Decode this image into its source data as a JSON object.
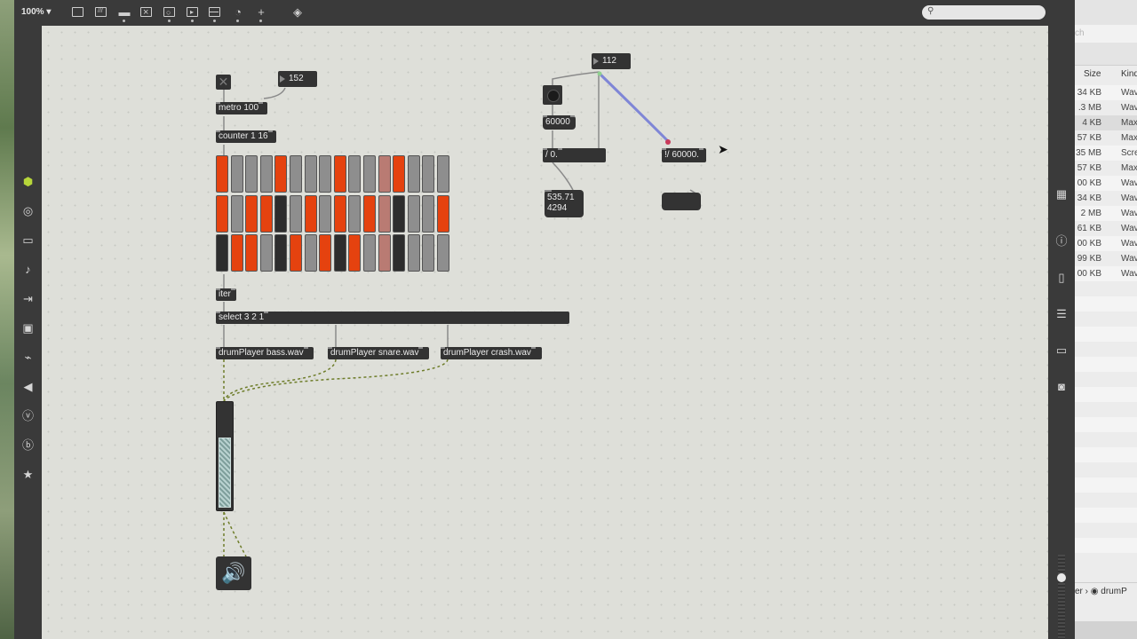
{
  "toolbar": {
    "zoom": "100%",
    "icons": [
      "presentation-icon",
      "text-edit-icon",
      "comment-icon",
      "close-box-icon",
      "grid-icon",
      "step-icon",
      "split-icon",
      "debug-icon",
      "add-icon",
      "paint-icon"
    ]
  },
  "patch": {
    "toggle_symbol": "✕",
    "tempo_number": "152",
    "metro_label": "metro 100",
    "counter_label": "counter 1 16",
    "iter_label": "iter",
    "select_label": "select 3 2 1",
    "drum_bass_label": "drumPlayer bass.wav",
    "drum_snare_label": "drumPlayer snare.wav",
    "drum_crash_label": "drumPlayer crash.wav",
    "bpm_number": "112",
    "ms_message": "60000",
    "divide_label": "/ 0.",
    "rdiv_label": "!/ 60000.",
    "result_line1": "535.71",
    "result_line2": "4294",
    "gain_level": 0.68,
    "dac_icon": "speaker-icon",
    "step_rows": [
      [
        "on",
        "off",
        "off",
        "off",
        "on",
        "off",
        "off",
        "off",
        "on",
        "off",
        "off",
        "hl",
        "on",
        "off",
        "off",
        "off"
      ],
      [
        "on",
        "off",
        "on",
        "on",
        "dark",
        "off",
        "on",
        "off",
        "on",
        "off",
        "on",
        "hl",
        "dark",
        "off",
        "off",
        "on"
      ],
      [
        "dark",
        "on",
        "on",
        "off",
        "dark",
        "on",
        "off",
        "on",
        "dark",
        "on",
        "off",
        "hl",
        "dark",
        "off",
        "off",
        "off"
      ]
    ]
  },
  "finder": {
    "search_stub": "ch",
    "col_size": "Size",
    "col_kind": "Kind",
    "rows": [
      {
        "size": "34 KB",
        "kind": "Wav"
      },
      {
        "size": ".3 MB",
        "kind": "Wav"
      },
      {
        "size": "4 KB",
        "kind": "Max"
      },
      {
        "size": "57 KB",
        "kind": "Max"
      },
      {
        "size": "35 MB",
        "kind": "Scre"
      },
      {
        "size": "57 KB",
        "kind": "Max"
      },
      {
        "size": "00 KB",
        "kind": "Wav"
      },
      {
        "size": "34 KB",
        "kind": "Wav"
      },
      {
        "size": "2 MB",
        "kind": "Wav"
      },
      {
        "size": "61 KB",
        "kind": "Wav"
      },
      {
        "size": "00 KB",
        "kind": "Wav"
      },
      {
        "size": "99 KB",
        "kind": "Wav"
      },
      {
        "size": "00 KB",
        "kind": "Wav"
      }
    ],
    "path_text": "er  ›  ◉  drumP"
  }
}
